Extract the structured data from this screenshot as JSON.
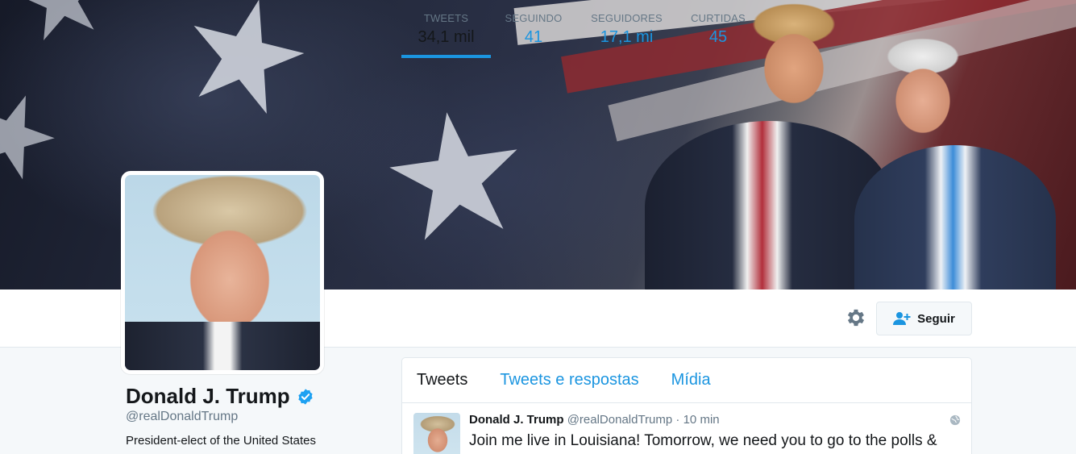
{
  "stats": [
    {
      "label": "TWEETS",
      "value": "34,1 mil"
    },
    {
      "label": "SEGUINDO",
      "value": "41"
    },
    {
      "label": "SEGUIDORES",
      "value": "17,1 mi"
    },
    {
      "label": "CURTIDAS",
      "value": "45"
    }
  ],
  "actions": {
    "follow_label": "Seguir",
    "settings_icon": "gear-icon",
    "follow_icon": "add-user-icon"
  },
  "profile": {
    "name": "Donald J. Trump",
    "handle": "@realDonaldTrump",
    "bio": "President-elect of the United States",
    "verified_icon": "verified-badge-icon"
  },
  "timeline": {
    "tabs": [
      "Tweets",
      "Tweets e respostas",
      "Mídia"
    ],
    "tweet": {
      "name": "Donald J. Trump",
      "handle": "@realDonaldTrump",
      "separator": "·",
      "time": "10 min",
      "text": "Join me live in Louisiana! Tomorrow, we need you to go to the polls &"
    }
  },
  "colors": {
    "accent": "#1b95e0",
    "text": "#14171a",
    "muted": "#657786",
    "background": "#f5f8fa"
  }
}
